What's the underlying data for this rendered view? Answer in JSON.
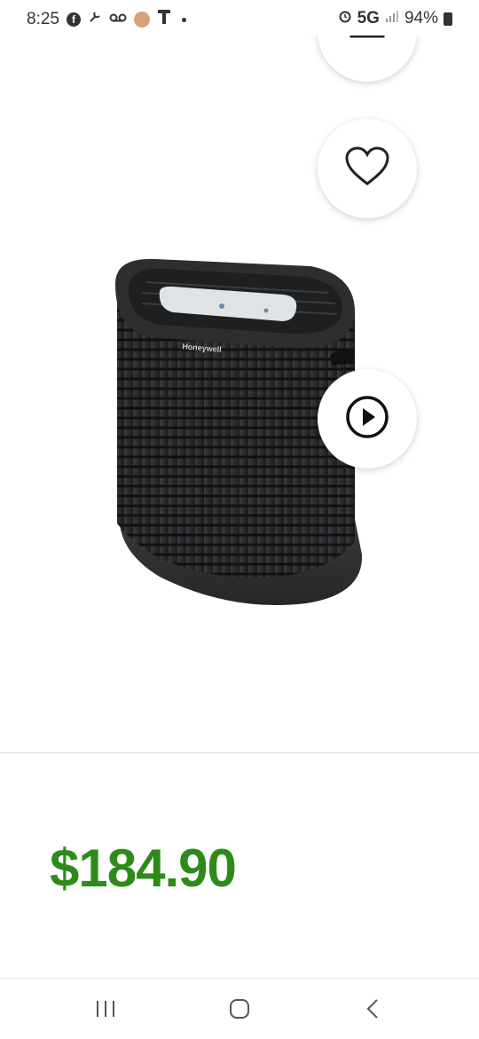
{
  "status_bar": {
    "time": "8:25",
    "network": "5G",
    "battery": "94%",
    "icons": [
      "facebook-icon",
      "tools-icon",
      "voicemail-icon",
      "avatar-icon",
      "tmobile-icon",
      "dot-icon",
      "alarm-icon",
      "signal-icon",
      "battery-icon"
    ]
  },
  "product": {
    "brand_label": "Honeywell",
    "price": "$184.90",
    "accent_color": "#2e8b1a",
    "actions": [
      "share-icon",
      "heart-icon",
      "play-icon"
    ]
  },
  "nav": {
    "icons": [
      "recents-icon",
      "home-icon",
      "back-icon"
    ]
  }
}
